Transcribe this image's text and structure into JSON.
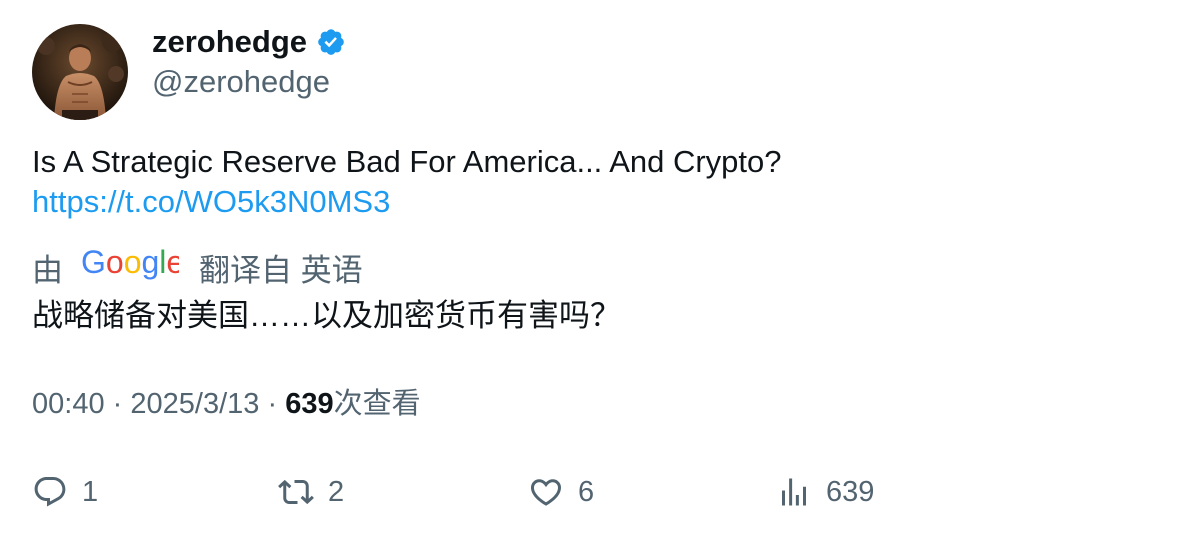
{
  "author": {
    "display_name": "zerohedge",
    "handle": "@zerohedge",
    "verified": true,
    "verified_color": "#1d9bf0"
  },
  "tweet": {
    "text": "Is A Strategic Reserve Bad For America... And Crypto?",
    "link": "https://t.co/WO5k3N0MS3",
    "link_color": "#1d9bf0"
  },
  "translation": {
    "prefix": "由",
    "provider": "Google",
    "suffix": "翻译自 英语",
    "text": "战略储备对美国……以及加密货币有害吗？"
  },
  "meta": {
    "time": "00:40",
    "separator": "·",
    "date": "2025/3/13",
    "views_count": "639",
    "views_label": "次查看"
  },
  "actions": {
    "reply": {
      "icon": "reply-icon",
      "count": "1"
    },
    "retweet": {
      "icon": "retweet-icon",
      "count": "2"
    },
    "like": {
      "icon": "heart-icon",
      "count": "6"
    },
    "views": {
      "icon": "analytics-icon",
      "count": "639"
    }
  }
}
